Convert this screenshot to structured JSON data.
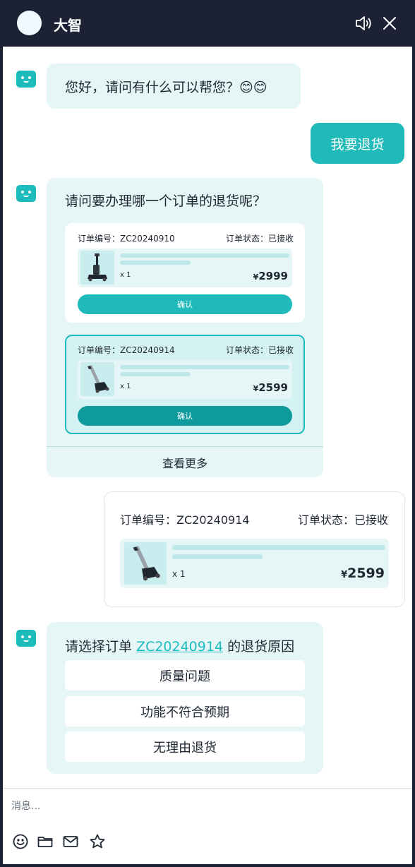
{
  "header": {
    "title": "大智",
    "icons": [
      "avatar",
      "speaker-icon",
      "close-icon"
    ]
  },
  "messages": {
    "greeting": "您好，请问有什么可以帮您？😊😊",
    "user_request": "我要退货",
    "order_question": "请问要办理哪一个订单的退货呢？",
    "orders": [
      {
        "order_label": "订单编号：ZC20240910",
        "status_label": "订单状态：已接收",
        "qty": "x 1",
        "currency": "¥",
        "price": "2999",
        "confirm": "确认"
      },
      {
        "order_label": "订单编号：ZC20240914",
        "status_label": "订单状态：已接收",
        "qty": "x 1",
        "currency": "¥",
        "price": "2599",
        "confirm": "确认"
      }
    ],
    "view_more": "查看更多",
    "selected_order": {
      "order_label": "订单编号：ZC20240914",
      "status_label": "订单状态：已接收",
      "qty": "x 1",
      "currency": "¥",
      "price": "2599"
    },
    "reason_prefix": "请选择订单 ",
    "reason_order_link": "ZC20240914",
    "reason_suffix": " 的退货原因",
    "reasons": [
      "质量问题",
      "功能不符合预期",
      "无理由退货"
    ]
  },
  "composer": {
    "placeholder": "消息..."
  },
  "colors": {
    "header_bg": "#1c2233",
    "accent": "#21babb",
    "bubble_bg": "#e6f6f7",
    "selected_button": "#0f9a9c"
  }
}
